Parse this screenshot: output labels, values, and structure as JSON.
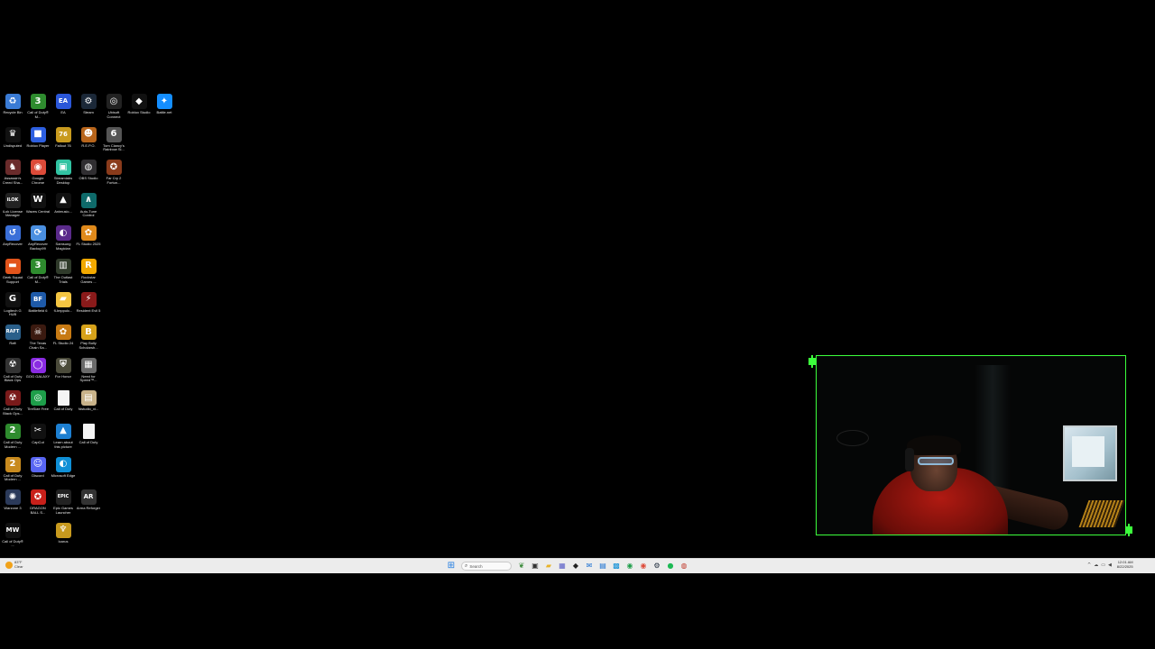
{
  "desktop": {
    "icons": [
      {
        "label": "Recycle Bin",
        "icon": "recycle-bin-icon",
        "glyph": "♻",
        "bg": "#3a7bd5"
      },
      {
        "label": "Call of Duty® M...",
        "icon": "call-of-duty-mw3-icon",
        "glyph": "3",
        "bg": "#2e8b2e"
      },
      {
        "label": "EA",
        "icon": "ea-icon",
        "glyph": "EA",
        "bg": "#2b57d9"
      },
      {
        "label": "Steam",
        "icon": "steam-icon",
        "glyph": "⚙",
        "bg": "#1b2838"
      },
      {
        "label": "Ubisoft Connect",
        "icon": "ubisoft-icon",
        "glyph": "◎",
        "bg": "#222"
      },
      {
        "label": "Roblox Studio",
        "icon": "roblox-studio-icon",
        "glyph": "◆",
        "bg": "#111"
      },
      {
        "label": "Battle.net",
        "icon": "battlenet-icon",
        "glyph": "✦",
        "bg": "#148eff"
      },
      {
        "label": "Undisputed",
        "icon": "undisputed-icon",
        "glyph": "♛",
        "bg": "#111"
      },
      {
        "label": "Roblox Player",
        "icon": "roblox-player-icon",
        "glyph": "■",
        "bg": "#2d5fe0"
      },
      {
        "label": "Fallout 76",
        "icon": "fallout-76-icon",
        "glyph": "76",
        "bg": "#c89a1e"
      },
      {
        "label": "R.E.P.O.",
        "icon": "repo-icon",
        "glyph": "☻",
        "bg": "#b8651b"
      },
      {
        "label": "Tom Clancy's Rainbow Si...",
        "icon": "rainbow-six-icon",
        "glyph": "6",
        "bg": "#555"
      },
      {
        "label": "",
        "icon": "empty-slot",
        "glyph": "",
        "bg": "transparent"
      },
      {
        "label": "",
        "icon": "empty-slot",
        "glyph": "",
        "bg": "transparent"
      },
      {
        "label": "Assassin's Creed Sha...",
        "icon": "assassins-creed-icon",
        "glyph": "♞",
        "bg": "#6a2b2b"
      },
      {
        "label": "Google Chrome",
        "icon": "chrome-icon",
        "glyph": "◉",
        "bg": "#dd4b39"
      },
      {
        "label": "Streamlabs Desktop",
        "icon": "streamlabs-icon",
        "glyph": "▣",
        "bg": "#31c3a2"
      },
      {
        "label": "OBS Studio",
        "icon": "obs-icon",
        "glyph": "◍",
        "bg": "#302e31"
      },
      {
        "label": "Far Cry 2 Fortun...",
        "icon": "far-cry-icon",
        "glyph": "✪",
        "bg": "#8a3b1b"
      },
      {
        "label": "",
        "icon": "empty-slot",
        "glyph": "",
        "bg": "transparent"
      },
      {
        "label": "",
        "icon": "empty-slot",
        "glyph": "",
        "bg": "transparent"
      },
      {
        "label": "iLok License Manager",
        "icon": "ilok-icon",
        "glyph": "iLOK",
        "bg": "#222"
      },
      {
        "label": "Waves Central",
        "icon": "waves-icon",
        "glyph": "W",
        "bg": "#111"
      },
      {
        "label": "Animusic...",
        "icon": "animusic-icon",
        "glyph": "▲",
        "bg": "#111"
      },
      {
        "label": "Auto-Tune Control",
        "icon": "auto-tune-icon",
        "glyph": "∧",
        "bg": "#0e6a6a"
      },
      {
        "label": "",
        "icon": "empty-slot",
        "glyph": "",
        "bg": "transparent"
      },
      {
        "label": "",
        "icon": "empty-slot",
        "glyph": "",
        "bg": "transparent"
      },
      {
        "label": "",
        "icon": "empty-slot",
        "glyph": "",
        "bg": "transparent"
      },
      {
        "label": "AnyRecover",
        "icon": "anyrecover-icon",
        "glyph": "↺",
        "bg": "#3a6fd8"
      },
      {
        "label": "AnyRecover Backup99",
        "icon": "anyrecover-backup-icon",
        "glyph": "⟳",
        "bg": "#4a8fe0"
      },
      {
        "label": "Samsung Magician",
        "icon": "samsung-magician-icon",
        "glyph": "◐",
        "bg": "#5a2a8a"
      },
      {
        "label": "FL Studio 2025",
        "icon": "fl-studio-icon",
        "glyph": "✿",
        "bg": "#e08a1b"
      },
      {
        "label": "",
        "icon": "empty-slot",
        "glyph": "",
        "bg": "transparent"
      },
      {
        "label": "",
        "icon": "empty-slot",
        "glyph": "",
        "bg": "transparent"
      },
      {
        "label": "",
        "icon": "empty-slot",
        "glyph": "",
        "bg": "transparent"
      },
      {
        "label": "Geek Squad Support",
        "icon": "geek-squad-icon",
        "glyph": "▬",
        "bg": "#e2541b"
      },
      {
        "label": "Call of Duty® M...",
        "icon": "call-of-duty-mw3-icon",
        "glyph": "3",
        "bg": "#2e8b2e"
      },
      {
        "label": "The Outlast Trials",
        "icon": "outlast-icon",
        "glyph": "▥",
        "bg": "#2f3a2a"
      },
      {
        "label": "Rockstar Games ...",
        "icon": "rockstar-icon",
        "glyph": "R",
        "bg": "#f2a900"
      },
      {
        "label": "",
        "icon": "empty-slot",
        "glyph": "",
        "bg": "transparent"
      },
      {
        "label": "",
        "icon": "empty-slot",
        "glyph": "",
        "bg": "transparent"
      },
      {
        "label": "",
        "icon": "empty-slot",
        "glyph": "",
        "bg": "transparent"
      },
      {
        "label": "Logitech G HUB",
        "icon": "logitech-ghub-icon",
        "glyph": "G",
        "bg": "#111"
      },
      {
        "label": "Battlefield 6",
        "icon": "battlefield-icon",
        "glyph": "BF",
        "bg": "#1e5aa8"
      },
      {
        "label": "fl-Imppulc...",
        "icon": "folder-icon",
        "glyph": "▰",
        "bg": "#f4c542"
      },
      {
        "label": "Resident Evil 5",
        "icon": "resident-evil-icon",
        "glyph": "⚡",
        "bg": "#8a1a1a"
      },
      {
        "label": "",
        "icon": "empty-slot",
        "glyph": "",
        "bg": "transparent"
      },
      {
        "label": "",
        "icon": "empty-slot",
        "glyph": "",
        "bg": "transparent"
      },
      {
        "label": "",
        "icon": "empty-slot",
        "glyph": "",
        "bg": "transparent"
      },
      {
        "label": "Raft",
        "icon": "raft-icon",
        "glyph": "RAFT",
        "bg": "#2a5f8a"
      },
      {
        "label": "The Texas Chain Sa...",
        "icon": "texas-chainsaw-icon",
        "glyph": "☠",
        "bg": "#3b1a10"
      },
      {
        "label": "FL Studio 24",
        "icon": "fl-studio-24-icon",
        "glyph": "✿",
        "bg": "#c77a14"
      },
      {
        "label": "Play Bully Scholarsh...",
        "icon": "bully-icon",
        "glyph": "B",
        "bg": "#d6a21a"
      },
      {
        "label": "",
        "icon": "empty-slot",
        "glyph": "",
        "bg": "transparent"
      },
      {
        "label": "",
        "icon": "empty-slot",
        "glyph": "",
        "bg": "transparent"
      },
      {
        "label": "",
        "icon": "empty-slot",
        "glyph": "",
        "bg": "transparent"
      },
      {
        "label": "Call of Duty Black Ops",
        "icon": "cod-black-ops-icon",
        "glyph": "☢",
        "bg": "#333"
      },
      {
        "label": "GOG GALAXY",
        "icon": "gog-galaxy-icon",
        "glyph": "◯",
        "bg": "#8a2be2"
      },
      {
        "label": "For Honor",
        "icon": "for-honor-icon",
        "glyph": "⛨",
        "bg": "#4a4a3a"
      },
      {
        "label": "Need for Speed™...",
        "icon": "need-for-speed-icon",
        "glyph": "▦",
        "bg": "#6a6a6a"
      },
      {
        "label": "",
        "icon": "empty-slot",
        "glyph": "",
        "bg": "transparent"
      },
      {
        "label": "",
        "icon": "empty-slot",
        "glyph": "",
        "bg": "transparent"
      },
      {
        "label": "",
        "icon": "empty-slot",
        "glyph": "",
        "bg": "transparent"
      },
      {
        "label": "Call of Duty Black Ops...",
        "icon": "cod-black-ops-2-icon",
        "glyph": "☢",
        "bg": "#7a1a1a"
      },
      {
        "label": "TireSize Free",
        "icon": "tiresize-icon",
        "glyph": "◎",
        "bg": "#1e9e4a"
      },
      {
        "label": "Call of Duty",
        "icon": "file-icon",
        "glyph": "",
        "bg": "#f4f4f4"
      },
      {
        "label": "fdstudio_vi...",
        "icon": "installer-icon",
        "glyph": "▤",
        "bg": "#c9b38a"
      },
      {
        "label": "",
        "icon": "empty-slot",
        "glyph": "",
        "bg": "transparent"
      },
      {
        "label": "",
        "icon": "empty-slot",
        "glyph": "",
        "bg": "transparent"
      },
      {
        "label": "",
        "icon": "empty-slot",
        "glyph": "",
        "bg": "transparent"
      },
      {
        "label": "Call of Duty Modern ...",
        "icon": "cod-mw2-icon",
        "glyph": "2",
        "bg": "#2e8b2e"
      },
      {
        "label": "CapCut",
        "icon": "capcut-icon",
        "glyph": "✂",
        "bg": "#111"
      },
      {
        "label": "Learn about this picture",
        "icon": "learn-about-picture-icon",
        "glyph": "▲",
        "bg": "#1d7fd1"
      },
      {
        "label": "Call of Duty",
        "icon": "file-icon",
        "glyph": "",
        "bg": "#f4f4f4"
      },
      {
        "label": "",
        "icon": "empty-slot",
        "glyph": "",
        "bg": "transparent"
      },
      {
        "label": "",
        "icon": "empty-slot",
        "glyph": "",
        "bg": "transparent"
      },
      {
        "label": "",
        "icon": "empty-slot",
        "glyph": "",
        "bg": "transparent"
      },
      {
        "label": "Call of Duty Modern ...",
        "icon": "cod-mw-icon",
        "glyph": "2",
        "bg": "#c88a1e"
      },
      {
        "label": "Discord",
        "icon": "discord-icon",
        "glyph": "☺",
        "bg": "#5865f2"
      },
      {
        "label": "Microsoft Edge",
        "icon": "edge-icon",
        "glyph": "◐",
        "bg": "#0f8fd6"
      },
      {
        "label": "",
        "icon": "empty-slot",
        "glyph": "",
        "bg": "transparent"
      },
      {
        "label": "",
        "icon": "empty-slot",
        "glyph": "",
        "bg": "transparent"
      },
      {
        "label": "",
        "icon": "empty-slot",
        "glyph": "",
        "bg": "transparent"
      },
      {
        "label": "",
        "icon": "empty-slot",
        "glyph": "",
        "bg": "transparent"
      },
      {
        "label": "Warzone 3",
        "icon": "warzone-icon",
        "glyph": "✺",
        "bg": "#2b3a5a"
      },
      {
        "label": "DRAGON BALL S...",
        "icon": "dragon-ball-icon",
        "glyph": "✪",
        "bg": "#c8201a"
      },
      {
        "label": "Epic Games Launcher",
        "icon": "epic-games-icon",
        "glyph": "EPIC",
        "bg": "#222"
      },
      {
        "label": "Arma Reforger",
        "icon": "arma-reforger-icon",
        "glyph": "AR",
        "bg": "#333"
      },
      {
        "label": "",
        "icon": "empty-slot",
        "glyph": "",
        "bg": "transparent"
      },
      {
        "label": "",
        "icon": "empty-slot",
        "glyph": "",
        "bg": "transparent"
      },
      {
        "label": "",
        "icon": "empty-slot",
        "glyph": "",
        "bg": "transparent"
      },
      {
        "label": "Call of Duty® ...",
        "icon": "cod-mw-classic-icon",
        "glyph": "MW",
        "bg": "#111"
      },
      {
        "label": "",
        "icon": "empty-slot",
        "glyph": "",
        "bg": "transparent"
      },
      {
        "label": "Icarus",
        "icon": "icarus-icon",
        "glyph": "♆",
        "bg": "#c89a1e"
      }
    ]
  },
  "webcam": {
    "border_color": "#3cff3c"
  },
  "taskbar": {
    "weather_temp": "83°F",
    "weather_cond": "Clear",
    "search_placeholder": "Search",
    "pinned": [
      {
        "name": "widgets-taskbar-icon",
        "glyph": "❦",
        "color": "#3a8a3a"
      },
      {
        "name": "task-view-taskbar-icon",
        "glyph": "▣",
        "color": "#333"
      },
      {
        "name": "file-explorer-taskbar-icon",
        "glyph": "▰",
        "color": "#e8b32a"
      },
      {
        "name": "teams-taskbar-icon",
        "glyph": "▦",
        "color": "#5b5fc7"
      },
      {
        "name": "epic-taskbar-icon",
        "glyph": "◆",
        "color": "#222"
      },
      {
        "name": "mail-taskbar-icon",
        "glyph": "✉",
        "color": "#1a6fd1"
      },
      {
        "name": "store-taskbar-icon",
        "glyph": "▤",
        "color": "#1a6fd1"
      },
      {
        "name": "photos-taskbar-icon",
        "glyph": "▩",
        "color": "#0f8fd6"
      },
      {
        "name": "xbox-taskbar-icon",
        "glyph": "◉",
        "color": "#1e9e4a"
      },
      {
        "name": "chrome-taskbar-icon",
        "glyph": "◉",
        "color": "#dd4b39"
      },
      {
        "name": "steam-taskbar-icon",
        "glyph": "⚙",
        "color": "#1b2838"
      },
      {
        "name": "spotify-taskbar-icon",
        "glyph": "●",
        "color": "#1db954"
      },
      {
        "name": "obs-taskbar-icon",
        "glyph": "◍",
        "color": "#c0392b"
      }
    ],
    "tray_icons": [
      "^",
      "☁",
      "▭",
      "◀"
    ],
    "clock_time": "12:01 AM",
    "clock_date": "8/22/2025"
  }
}
